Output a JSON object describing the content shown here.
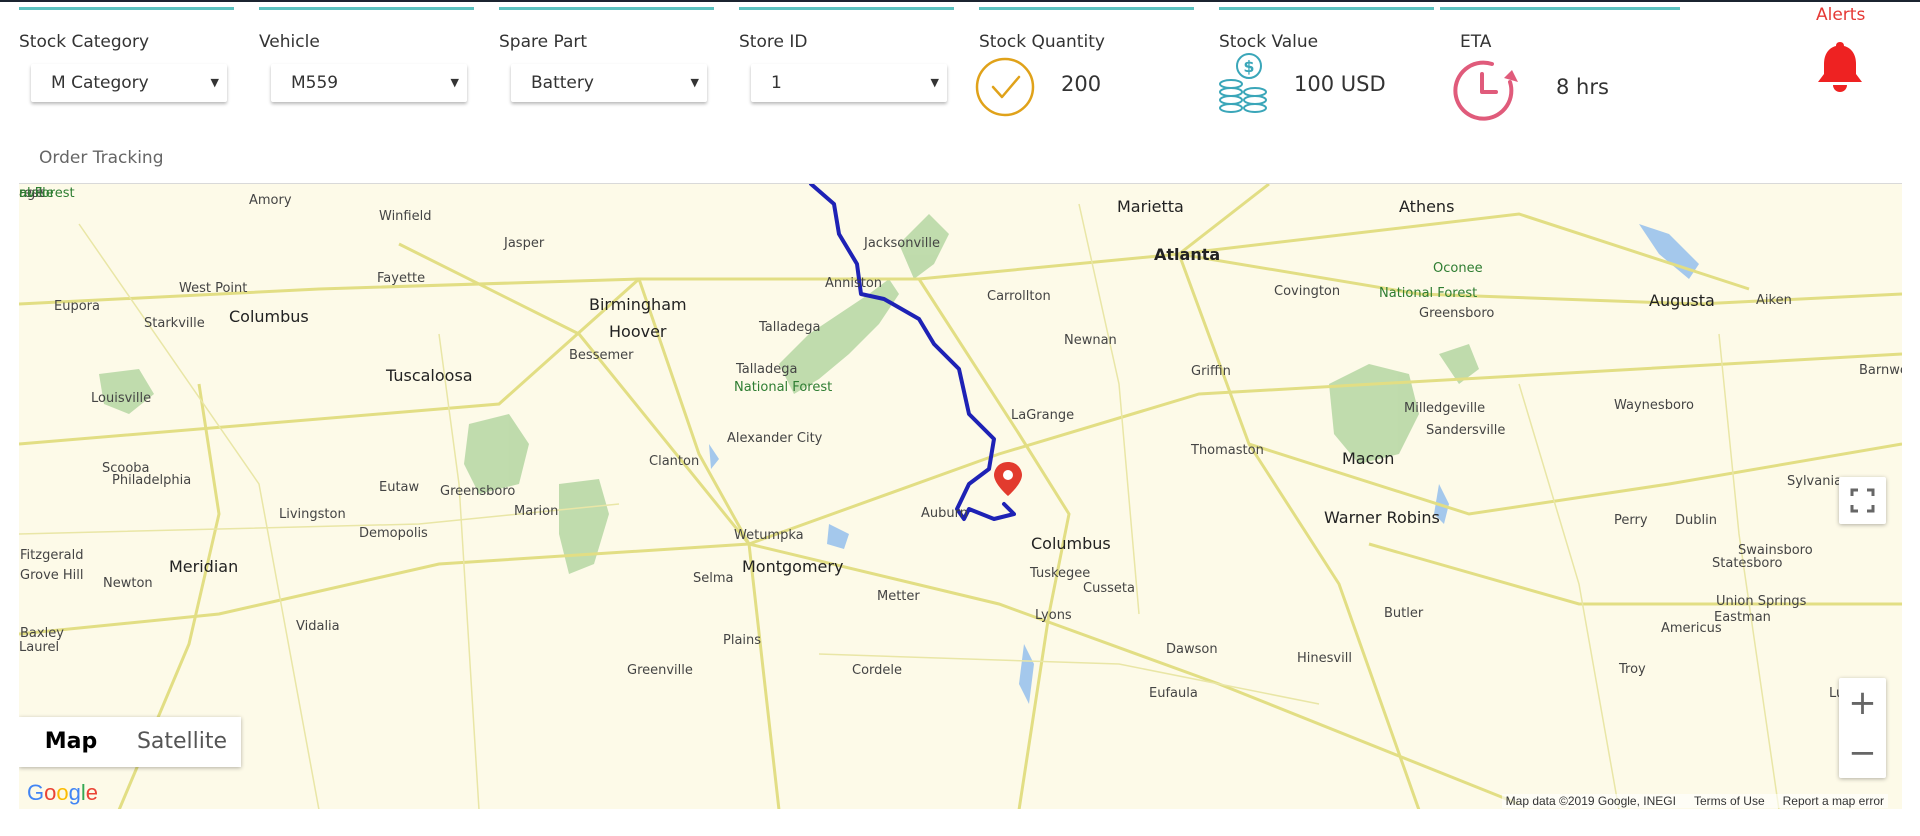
{
  "filters": [
    {
      "label": "Stock Category",
      "value": "M Category"
    },
    {
      "label": "Vehicle",
      "value": "M559"
    },
    {
      "label": "Spare Part",
      "value": "Battery"
    },
    {
      "label": "Store ID",
      "value": "1"
    }
  ],
  "metrics": {
    "stock_quantity": {
      "label": "Stock Quantity",
      "value": "200",
      "icon": "check-circle-icon",
      "color": "#e0a21a"
    },
    "stock_value": {
      "label": "Stock Value",
      "value": "100 USD",
      "icon": "coins-dollar-icon",
      "color": "#3aa6b9"
    },
    "eta": {
      "label": "ETA",
      "value": "8 hrs",
      "icon": "clock-refresh-icon",
      "color": "#e05b7b"
    }
  },
  "alerts": {
    "label": "Alerts",
    "icon": "bell-icon",
    "color": "#e53935"
  },
  "order_tracking": {
    "title": "Order Tracking",
    "map": {
      "type_buttons": {
        "map": "Map",
        "satellite": "Satellite"
      },
      "attribution": {
        "data": "Map data ©2019 Google, INEGI",
        "terms": "Terms of Use",
        "report": "Report a map error"
      },
      "logo": "Google",
      "zoom_in": "+",
      "zoom_out": "−",
      "places": [
        "Amory",
        "Winfield",
        "Jasper",
        "Marietta",
        "Atlanta",
        "Athens",
        "Jacksonville",
        "Fayette",
        "Anniston",
        "Carrollton",
        "Covington",
        "Oconee",
        "National Forest",
        "West Point",
        "Eupora",
        "Columbus",
        "Birmingham",
        "Greensboro",
        "Augusta",
        "Aiken",
        "Starkville",
        "Talladega",
        "Hoover",
        "Newnan",
        "Bessemer",
        "Tuscaloosa",
        "Talladega",
        "National Forest",
        "Griffin",
        "Barnwell",
        "Louisville",
        "Milledgeville",
        "Waynesboro",
        "LaGrange",
        "Sandersville",
        "Alexander City",
        "Clanton",
        "Thomaston",
        "Macon",
        "Scooba",
        "Eutaw",
        "Philadelphia",
        "Greensboro",
        "Sylvania",
        "Marion",
        "Livingston",
        "Auburn",
        "Warner Robins",
        "Demopolis",
        "Wetumpka",
        "Columbus",
        "Perry",
        "Swainsboro",
        "Dublin",
        "Statesboro",
        "Meridian",
        "Selma",
        "Tuskegee",
        "Montgomery",
        "Newton",
        "Cusseta",
        "Metter",
        "Union Springs",
        "Eastman",
        "Vidalia",
        "Lyons",
        "Butler",
        "Americus",
        "Plains",
        "Cordele",
        "Greenville",
        "Troy",
        "Eufaula",
        "Dawson",
        "Hinesvill",
        "Luverne",
        "Grove Hill",
        "Fitzgerald",
        "Baxley",
        "Laurel",
        "Lexi",
        "age",
        "rest",
        "nville",
        "al Forest"
      ]
    }
  }
}
